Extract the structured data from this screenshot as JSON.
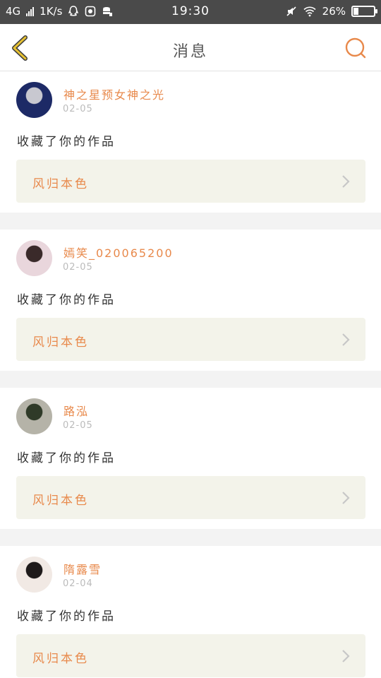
{
  "status_bar": {
    "network": "4G",
    "speed": "1K/s",
    "time": "19:30",
    "battery_percent": "26%",
    "battery_level": 0.26
  },
  "nav": {
    "title": "消息"
  },
  "messages": [
    {
      "user": "神之星预女神之光",
      "date": "02-05",
      "action": "收藏了你的作品",
      "work": "风归本色",
      "avatar_colors": [
        "#1d2a66",
        "#c8c8d0"
      ]
    },
    {
      "user": "嫣笑_020065200",
      "date": "02-05",
      "action": "收藏了你的作品",
      "work": "风归本色",
      "avatar_colors": [
        "#e9d6dc",
        "#3a2a2a"
      ]
    },
    {
      "user": "路泓",
      "date": "02-05",
      "action": "收藏了你的作品",
      "work": "风归本色",
      "avatar_colors": [
        "#b5b3a8",
        "#2f3a28"
      ]
    },
    {
      "user": "隋露雪",
      "date": "02-04",
      "action": "收藏了你的作品",
      "work": "风归本色",
      "avatar_colors": [
        "#f1e9e4",
        "#1e1a1a"
      ]
    }
  ],
  "colors": {
    "accent": "#e8894b",
    "back_arrow": "#c9a92c",
    "card_link_bg": "#f3f3ea",
    "separator": "#f3f3f3"
  }
}
